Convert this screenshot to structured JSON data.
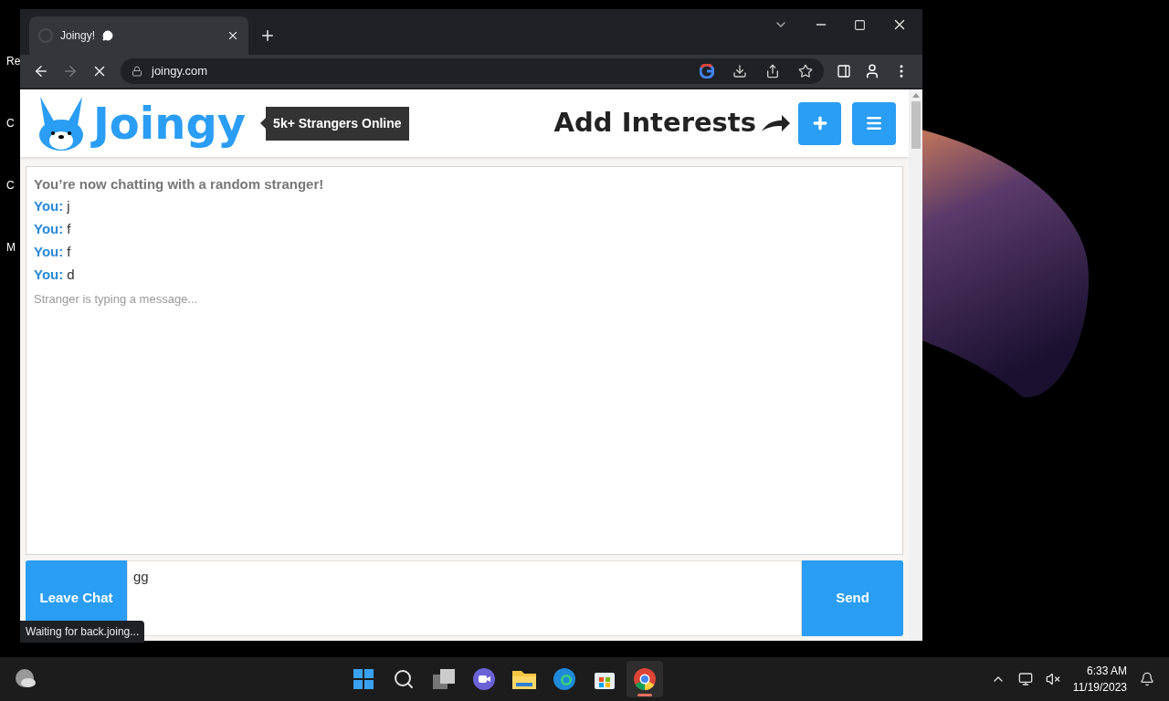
{
  "desktop_icons": [
    {
      "label": "Re"
    },
    {
      "label": "C"
    },
    {
      "label": "C"
    },
    {
      "label": "M"
    }
  ],
  "browser": {
    "tabs": [
      {
        "title": "Joingy!",
        "selected": true
      }
    ],
    "address": "joingy.com",
    "loading": true
  },
  "site": {
    "logo": "Joingy",
    "online_badge": "5k+ Strangers Online",
    "add_interests": "Add Interests"
  },
  "chat": {
    "notice": "You’re now chatting with a random stranger!",
    "messages": [
      {
        "sender": "You:",
        "text": "j"
      },
      {
        "sender": "You:",
        "text": "f"
      },
      {
        "sender": "You:",
        "text": "f"
      },
      {
        "sender": "You:",
        "text": "d"
      }
    ],
    "typing": "Stranger is typing a message...",
    "leave_button": "Leave Chat",
    "input_value": "gg",
    "send_button": "Send"
  },
  "status_bubble": "Waiting for back.joing...",
  "taskbar": {
    "apps": [
      {
        "kind": "start",
        "selected": false
      },
      {
        "kind": "search",
        "selected": false
      },
      {
        "kind": "taskview",
        "selected": false
      },
      {
        "kind": "chat",
        "selected": false
      },
      {
        "kind": "folder",
        "selected": false
      },
      {
        "kind": "edge",
        "selected": false
      },
      {
        "kind": "store",
        "selected": false
      },
      {
        "kind": "chrome",
        "selected": true
      }
    ],
    "time": "6:33 AM",
    "date": "11/19/2023"
  }
}
